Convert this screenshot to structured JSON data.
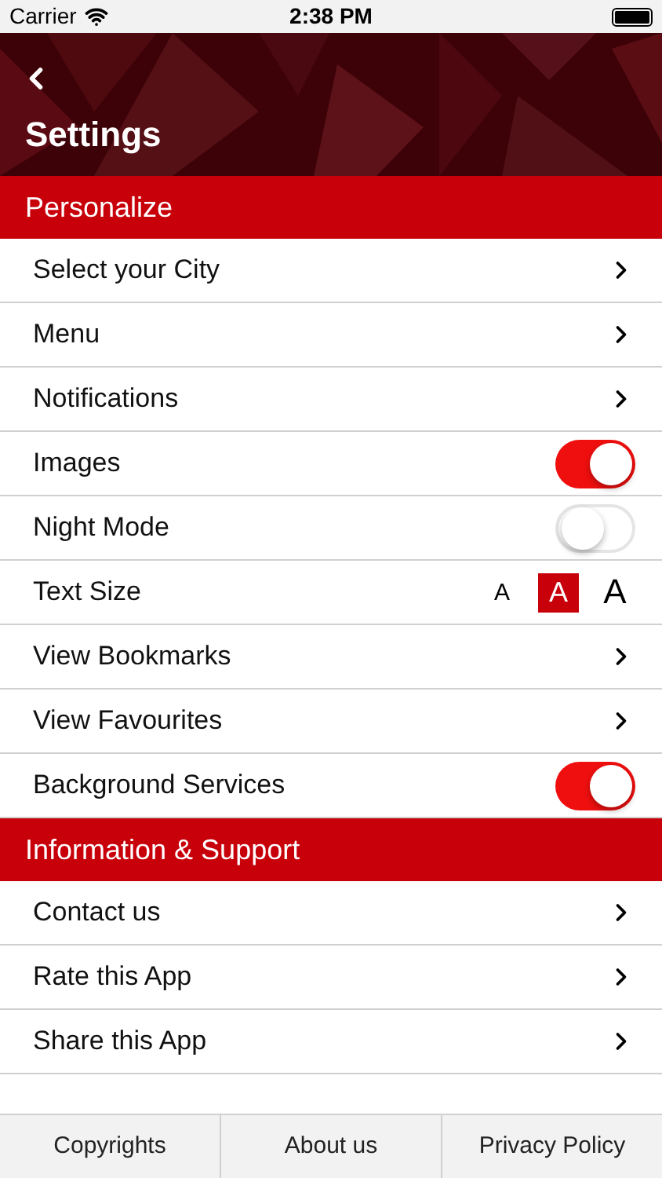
{
  "status_bar": {
    "carrier": "Carrier",
    "time": "2:38 PM"
  },
  "header": {
    "title": "Settings"
  },
  "sections": [
    {
      "title": "Personalize",
      "rows": [
        {
          "kind": "link",
          "label": "Select your City"
        },
        {
          "kind": "link",
          "label": "Menu"
        },
        {
          "kind": "link",
          "label": "Notifications"
        },
        {
          "kind": "toggle",
          "label": "Images",
          "on": true
        },
        {
          "kind": "toggle",
          "label": "Night Mode",
          "on": false
        },
        {
          "kind": "text_size",
          "label": "Text Size",
          "options": [
            {
              "label": "A",
              "selected": false
            },
            {
              "label": "A",
              "selected": true
            },
            {
              "label": "A",
              "selected": false
            }
          ]
        },
        {
          "kind": "link",
          "label": "View Bookmarks"
        },
        {
          "kind": "link",
          "label": "View Favourites"
        },
        {
          "kind": "toggle",
          "label": "Background Services",
          "on": true
        }
      ]
    },
    {
      "title": "Information & Support",
      "rows": [
        {
          "kind": "link",
          "label": "Contact us"
        },
        {
          "kind": "link",
          "label": "Rate this App"
        },
        {
          "kind": "link",
          "label": "Share this App"
        }
      ]
    }
  ],
  "footer_tabs": [
    "Copyrights",
    "About us",
    "Privacy Policy"
  ]
}
